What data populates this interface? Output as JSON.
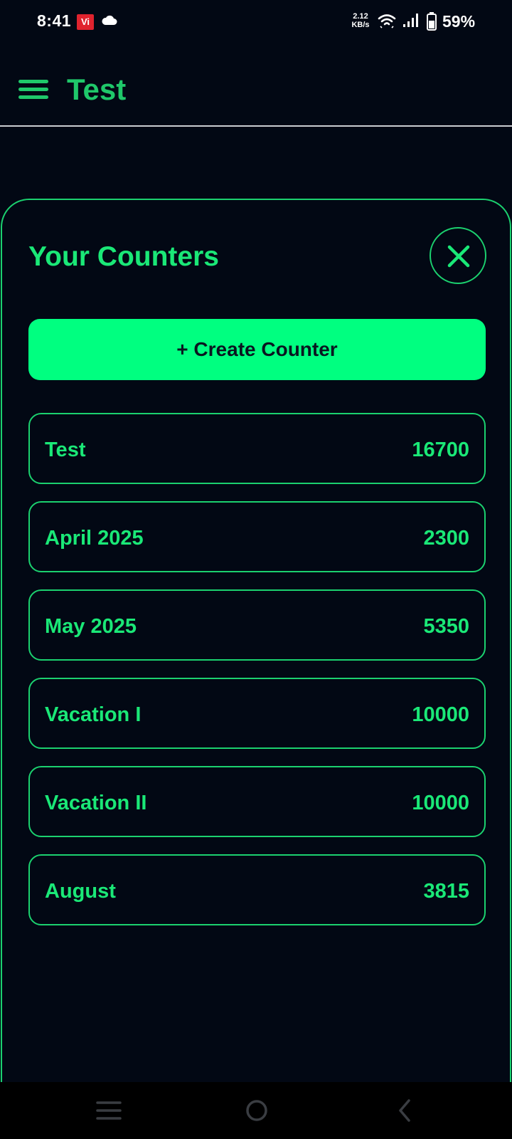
{
  "status_bar": {
    "time": "8:41",
    "carrier_badge": "Vi",
    "net_speed_value": "2.12",
    "net_speed_unit": "KB/s",
    "battery_percent": "59%",
    "icons": [
      "carrier-badge",
      "cloud-icon",
      "wifi-icon",
      "signal-icon",
      "battery-icon"
    ]
  },
  "app_bar": {
    "title": "Test",
    "menu_icon": "hamburger-menu-icon"
  },
  "sheet": {
    "title": "Your Counters",
    "close_icon": "close-icon",
    "create_button_label": "+ Create Counter",
    "counters": [
      {
        "name": "Test",
        "value": "16700"
      },
      {
        "name": "April 2025",
        "value": "2300"
      },
      {
        "name": "May 2025",
        "value": "5350"
      },
      {
        "name": "Vacation I",
        "value": "10000"
      },
      {
        "name": "Vacation II",
        "value": "10000"
      },
      {
        "name": "August",
        "value": "3815"
      }
    ]
  },
  "nav_bar": {
    "icons": [
      "recents-icon",
      "home-icon",
      "back-icon"
    ]
  },
  "colors": {
    "background": "#020814",
    "accent": "#1ae877",
    "button_fill": "#00ff80",
    "border": "#1bd16f",
    "carrier_red": "#e0232e"
  }
}
